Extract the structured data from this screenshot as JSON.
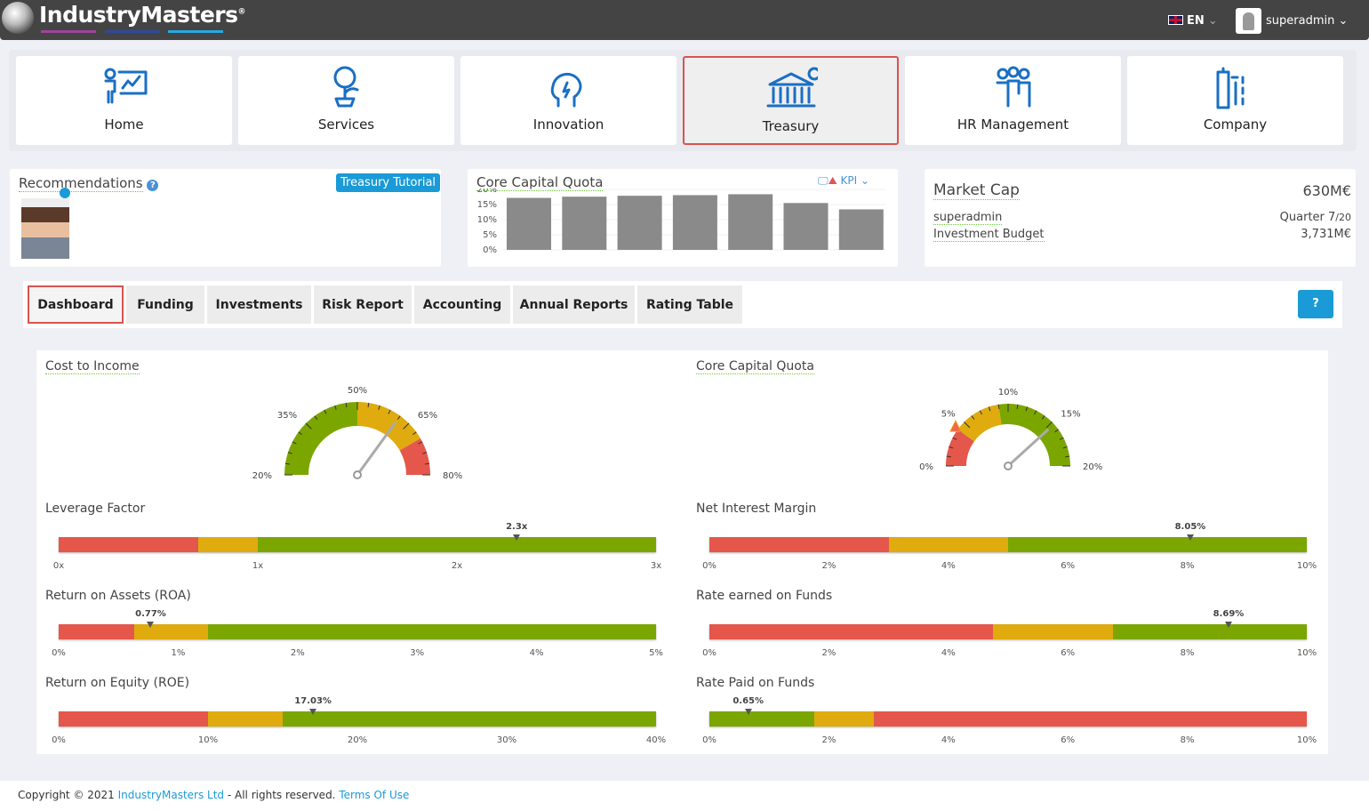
{
  "brand": {
    "name": "IndustryMasters",
    "registered": "®",
    "bar_colors": [
      "#a0449a",
      "#2e4a9c",
      "#29a8df"
    ]
  },
  "header": {
    "language": "EN",
    "username": "superadmin"
  },
  "nav": [
    {
      "label": "Home",
      "icon": "presenter-chart-icon"
    },
    {
      "label": "Services",
      "icon": "money-plant-icon"
    },
    {
      "label": "Innovation",
      "icon": "head-idea-icon"
    },
    {
      "label": "Treasury",
      "icon": "bank-icon",
      "active": true
    },
    {
      "label": "HR Management",
      "icon": "people-icon"
    },
    {
      "label": "Company",
      "icon": "building-icon"
    }
  ],
  "recommendations": {
    "title": "Recommendations",
    "tutorial_button": "Treasury Tutorial"
  },
  "kpi_widget": {
    "title": "Core Capital Quota",
    "selector": "KPI",
    "chart_data": {
      "type": "bar",
      "yticks": [
        "20%",
        "15%",
        "10%",
        "5%",
        "0%"
      ],
      "ylim": [
        0,
        20
      ],
      "values": [
        17.2,
        17.6,
        17.9,
        18.1,
        18.4,
        15.5,
        13.4
      ],
      "color": "#8a8a8a"
    }
  },
  "market": {
    "title": "Market Cap",
    "value": "630M€",
    "user": "superadmin",
    "quarter": "Quarter 7",
    "quarter_total": "/20",
    "budget_label": "Investment Budget",
    "budget_value": "3,731M€"
  },
  "tabs": [
    "Dashboard",
    "Funding",
    "Investments",
    "Risk Report",
    "Accounting",
    "Annual Reports",
    "Rating Table"
  ],
  "colors": {
    "red": "#e4574a",
    "yellow": "#dfab0e",
    "green": "#7ba600",
    "accent": "#1a9ad6"
  },
  "gauges": [
    {
      "title": "Cost to Income",
      "min": 20,
      "max": 80,
      "ticks": [
        "20%",
        "35%",
        "50%",
        "65%",
        "80%"
      ],
      "bands": [
        [
          20,
          50,
          "green"
        ],
        [
          50,
          70,
          "yellow"
        ],
        [
          70,
          80,
          "red"
        ]
      ],
      "value": 62
    },
    {
      "title": "Core Capital Quota",
      "min": 0,
      "max": 20,
      "ticks": [
        "0%",
        "5%",
        "10%",
        "15%",
        "20%"
      ],
      "bands": [
        [
          0,
          4,
          "red"
        ],
        [
          4,
          9,
          "yellow"
        ],
        [
          9,
          20,
          "green"
        ]
      ],
      "value": 15.3,
      "threshold": 4
    }
  ],
  "bars": [
    {
      "title": "Leverage Factor",
      "min": 0,
      "max": 3,
      "ticks": [
        "0x",
        "1x",
        "2x",
        "3x"
      ],
      "bands": [
        [
          0,
          0.7,
          "red"
        ],
        [
          0.7,
          1,
          "yellow"
        ],
        [
          1,
          3,
          "green"
        ]
      ],
      "value": 2.3,
      "value_label": "2.3x"
    },
    {
      "title": "Net Interest Margin",
      "min": 0,
      "max": 10,
      "ticks": [
        "0%",
        "2%",
        "4%",
        "6%",
        "8%",
        "10%"
      ],
      "bands": [
        [
          0,
          3,
          "red"
        ],
        [
          3,
          5,
          "yellow"
        ],
        [
          5,
          10,
          "green"
        ]
      ],
      "value": 8.05,
      "value_label": "8.05%"
    },
    {
      "title": "Return on Assets (ROA)",
      "min": 0,
      "max": 5,
      "ticks": [
        "0%",
        "1%",
        "2%",
        "3%",
        "4%",
        "5%"
      ],
      "bands": [
        [
          0,
          0.63,
          "red"
        ],
        [
          0.63,
          1.25,
          "yellow"
        ],
        [
          1.25,
          5,
          "green"
        ]
      ],
      "value": 0.77,
      "value_label": "0.77%"
    },
    {
      "title": "Rate earned on Funds",
      "min": 0,
      "max": 10,
      "ticks": [
        "0%",
        "2%",
        "4%",
        "6%",
        "8%",
        "10%"
      ],
      "bands": [
        [
          0,
          4.75,
          "red"
        ],
        [
          4.75,
          6.75,
          "yellow"
        ],
        [
          6.75,
          10,
          "green"
        ]
      ],
      "value": 8.69,
      "value_label": "8.69%"
    },
    {
      "title": "Return on Equity (ROE)",
      "min": 0,
      "max": 40,
      "ticks": [
        "0%",
        "10%",
        "20%",
        "30%",
        "40%"
      ],
      "bands": [
        [
          0,
          10,
          "red"
        ],
        [
          10,
          15,
          "yellow"
        ],
        [
          15,
          40,
          "green"
        ]
      ],
      "value": 17.03,
      "value_label": "17.03%"
    },
    {
      "title": "Rate Paid on Funds",
      "min": 0,
      "max": 10,
      "ticks": [
        "0%",
        "2%",
        "4%",
        "6%",
        "8%",
        "10%"
      ],
      "bands": [
        [
          0,
          1.75,
          "green"
        ],
        [
          1.75,
          2.75,
          "yellow"
        ],
        [
          2.75,
          10,
          "red"
        ]
      ],
      "value": 0.65,
      "value_label": "0.65%"
    }
  ],
  "footer": {
    "copyright": "Copyright © 2021 ",
    "company": "IndustryMasters Ltd",
    "rights": " - All rights reserved. ",
    "terms": "Terms Of Use"
  }
}
